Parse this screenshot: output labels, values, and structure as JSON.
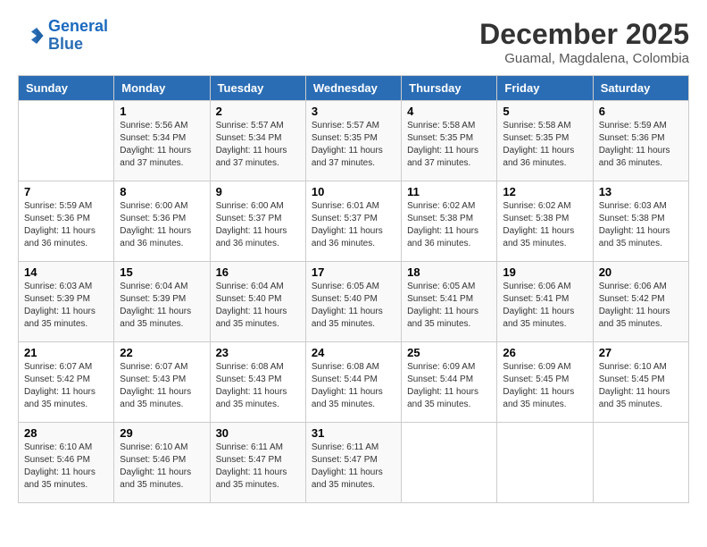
{
  "logo": {
    "line1": "General",
    "line2": "Blue"
  },
  "title": "December 2025",
  "subtitle": "Guamal, Magdalena, Colombia",
  "days_of_week": [
    "Sunday",
    "Monday",
    "Tuesday",
    "Wednesday",
    "Thursday",
    "Friday",
    "Saturday"
  ],
  "weeks": [
    [
      {
        "num": "",
        "sunrise": "",
        "sunset": "",
        "daylight": ""
      },
      {
        "num": "1",
        "sunrise": "Sunrise: 5:56 AM",
        "sunset": "Sunset: 5:34 PM",
        "daylight": "Daylight: 11 hours and 37 minutes."
      },
      {
        "num": "2",
        "sunrise": "Sunrise: 5:57 AM",
        "sunset": "Sunset: 5:34 PM",
        "daylight": "Daylight: 11 hours and 37 minutes."
      },
      {
        "num": "3",
        "sunrise": "Sunrise: 5:57 AM",
        "sunset": "Sunset: 5:35 PM",
        "daylight": "Daylight: 11 hours and 37 minutes."
      },
      {
        "num": "4",
        "sunrise": "Sunrise: 5:58 AM",
        "sunset": "Sunset: 5:35 PM",
        "daylight": "Daylight: 11 hours and 37 minutes."
      },
      {
        "num": "5",
        "sunrise": "Sunrise: 5:58 AM",
        "sunset": "Sunset: 5:35 PM",
        "daylight": "Daylight: 11 hours and 36 minutes."
      },
      {
        "num": "6",
        "sunrise": "Sunrise: 5:59 AM",
        "sunset": "Sunset: 5:36 PM",
        "daylight": "Daylight: 11 hours and 36 minutes."
      }
    ],
    [
      {
        "num": "7",
        "sunrise": "Sunrise: 5:59 AM",
        "sunset": "Sunset: 5:36 PM",
        "daylight": "Daylight: 11 hours and 36 minutes."
      },
      {
        "num": "8",
        "sunrise": "Sunrise: 6:00 AM",
        "sunset": "Sunset: 5:36 PM",
        "daylight": "Daylight: 11 hours and 36 minutes."
      },
      {
        "num": "9",
        "sunrise": "Sunrise: 6:00 AM",
        "sunset": "Sunset: 5:37 PM",
        "daylight": "Daylight: 11 hours and 36 minutes."
      },
      {
        "num": "10",
        "sunrise": "Sunrise: 6:01 AM",
        "sunset": "Sunset: 5:37 PM",
        "daylight": "Daylight: 11 hours and 36 minutes."
      },
      {
        "num": "11",
        "sunrise": "Sunrise: 6:02 AM",
        "sunset": "Sunset: 5:38 PM",
        "daylight": "Daylight: 11 hours and 36 minutes."
      },
      {
        "num": "12",
        "sunrise": "Sunrise: 6:02 AM",
        "sunset": "Sunset: 5:38 PM",
        "daylight": "Daylight: 11 hours and 35 minutes."
      },
      {
        "num": "13",
        "sunrise": "Sunrise: 6:03 AM",
        "sunset": "Sunset: 5:38 PM",
        "daylight": "Daylight: 11 hours and 35 minutes."
      }
    ],
    [
      {
        "num": "14",
        "sunrise": "Sunrise: 6:03 AM",
        "sunset": "Sunset: 5:39 PM",
        "daylight": "Daylight: 11 hours and 35 minutes."
      },
      {
        "num": "15",
        "sunrise": "Sunrise: 6:04 AM",
        "sunset": "Sunset: 5:39 PM",
        "daylight": "Daylight: 11 hours and 35 minutes."
      },
      {
        "num": "16",
        "sunrise": "Sunrise: 6:04 AM",
        "sunset": "Sunset: 5:40 PM",
        "daylight": "Daylight: 11 hours and 35 minutes."
      },
      {
        "num": "17",
        "sunrise": "Sunrise: 6:05 AM",
        "sunset": "Sunset: 5:40 PM",
        "daylight": "Daylight: 11 hours and 35 minutes."
      },
      {
        "num": "18",
        "sunrise": "Sunrise: 6:05 AM",
        "sunset": "Sunset: 5:41 PM",
        "daylight": "Daylight: 11 hours and 35 minutes."
      },
      {
        "num": "19",
        "sunrise": "Sunrise: 6:06 AM",
        "sunset": "Sunset: 5:41 PM",
        "daylight": "Daylight: 11 hours and 35 minutes."
      },
      {
        "num": "20",
        "sunrise": "Sunrise: 6:06 AM",
        "sunset": "Sunset: 5:42 PM",
        "daylight": "Daylight: 11 hours and 35 minutes."
      }
    ],
    [
      {
        "num": "21",
        "sunrise": "Sunrise: 6:07 AM",
        "sunset": "Sunset: 5:42 PM",
        "daylight": "Daylight: 11 hours and 35 minutes."
      },
      {
        "num": "22",
        "sunrise": "Sunrise: 6:07 AM",
        "sunset": "Sunset: 5:43 PM",
        "daylight": "Daylight: 11 hours and 35 minutes."
      },
      {
        "num": "23",
        "sunrise": "Sunrise: 6:08 AM",
        "sunset": "Sunset: 5:43 PM",
        "daylight": "Daylight: 11 hours and 35 minutes."
      },
      {
        "num": "24",
        "sunrise": "Sunrise: 6:08 AM",
        "sunset": "Sunset: 5:44 PM",
        "daylight": "Daylight: 11 hours and 35 minutes."
      },
      {
        "num": "25",
        "sunrise": "Sunrise: 6:09 AM",
        "sunset": "Sunset: 5:44 PM",
        "daylight": "Daylight: 11 hours and 35 minutes."
      },
      {
        "num": "26",
        "sunrise": "Sunrise: 6:09 AM",
        "sunset": "Sunset: 5:45 PM",
        "daylight": "Daylight: 11 hours and 35 minutes."
      },
      {
        "num": "27",
        "sunrise": "Sunrise: 6:10 AM",
        "sunset": "Sunset: 5:45 PM",
        "daylight": "Daylight: 11 hours and 35 minutes."
      }
    ],
    [
      {
        "num": "28",
        "sunrise": "Sunrise: 6:10 AM",
        "sunset": "Sunset: 5:46 PM",
        "daylight": "Daylight: 11 hours and 35 minutes."
      },
      {
        "num": "29",
        "sunrise": "Sunrise: 6:10 AM",
        "sunset": "Sunset: 5:46 PM",
        "daylight": "Daylight: 11 hours and 35 minutes."
      },
      {
        "num": "30",
        "sunrise": "Sunrise: 6:11 AM",
        "sunset": "Sunset: 5:47 PM",
        "daylight": "Daylight: 11 hours and 35 minutes."
      },
      {
        "num": "31",
        "sunrise": "Sunrise: 6:11 AM",
        "sunset": "Sunset: 5:47 PM",
        "daylight": "Daylight: 11 hours and 35 minutes."
      },
      {
        "num": "",
        "sunrise": "",
        "sunset": "",
        "daylight": ""
      },
      {
        "num": "",
        "sunrise": "",
        "sunset": "",
        "daylight": ""
      },
      {
        "num": "",
        "sunrise": "",
        "sunset": "",
        "daylight": ""
      }
    ]
  ]
}
